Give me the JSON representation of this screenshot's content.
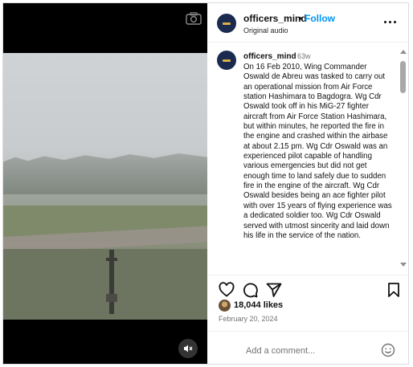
{
  "header": {
    "username": "officers_mind",
    "separator": "•",
    "follow_label": "Follow",
    "audio_label": "Original audio"
  },
  "caption": {
    "username": "officers_mind",
    "time_ago": "63w",
    "text": "On 16 Feb 2010, Wing Commander Oswald de Abreu was tasked to carry out an operational mission from Air Force station Hashimara to Bagdogra. Wg Cdr Oswald took off in his MiG-27 fighter aircraft from Air Force Station Hashimara, but within minutes, he reported the fire in the engine and crashed within the airbase at about 2.15 pm. Wg Cdr Oswald was an experienced pilot capable of handling various emergencies but did not get enough time to land safely due to sudden fire in the engine of the aircraft. Wg Cdr Oswald besides being an ace fighter pilot with over 15 years of flying experience was a dedicated soldier too. Wg Cdr Oswald served with utmost sincerity and laid down his life in the service of the nation."
  },
  "engagement": {
    "likes": "18,044 likes",
    "date": "February 20, 2024"
  },
  "comment": {
    "placeholder": "Add a comment..."
  },
  "icons": {
    "camera": "camera-icon",
    "mute": "speaker-muted-icon",
    "more": "more-options-icon",
    "like": "heart-icon",
    "comment": "comment-icon",
    "share": "send-icon",
    "save": "bookmark-icon",
    "emoji": "emoji-icon"
  },
  "colors": {
    "follow": "#0095f6",
    "muted_text": "#737373",
    "avatar_bg": "#1b2a4f"
  }
}
